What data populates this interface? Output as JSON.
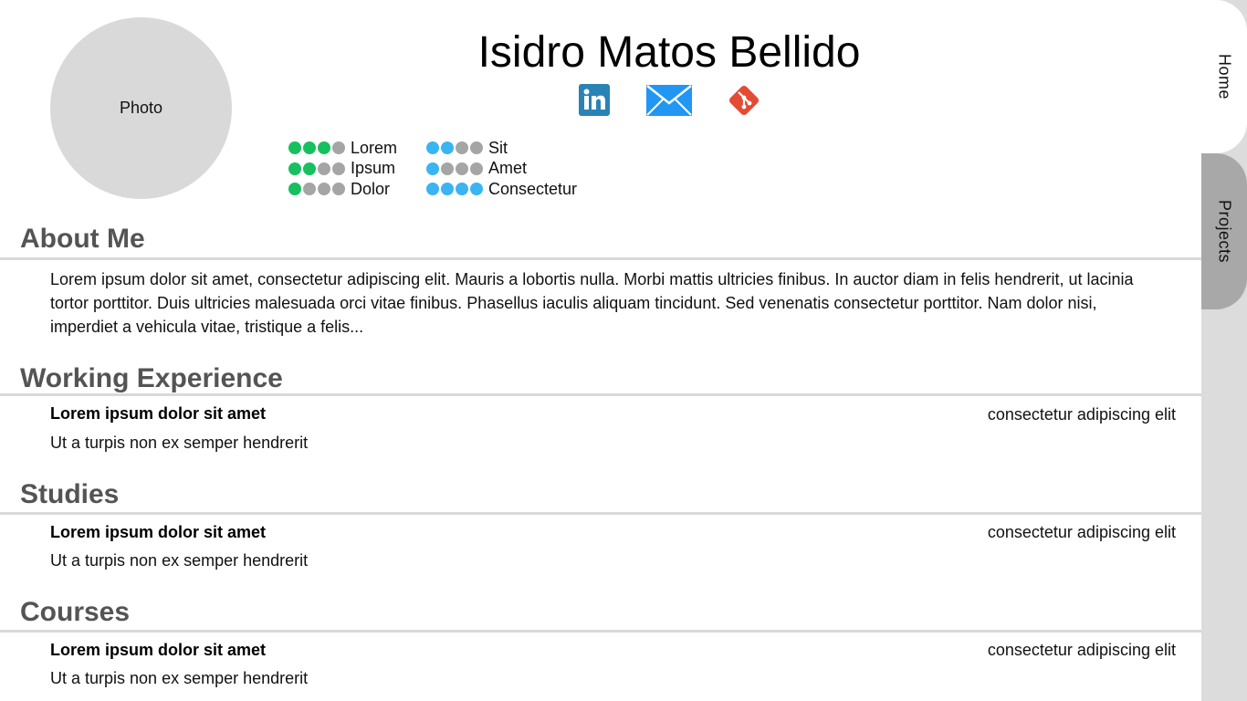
{
  "nav": {
    "tabs": [
      {
        "label": "Home"
      },
      {
        "label": "Projects"
      }
    ]
  },
  "profile": {
    "photo_label": "Photo",
    "name": "Isidro Matos Bellido",
    "socials": [
      {
        "icon": "linkedin-icon",
        "color": "#2a83b5"
      },
      {
        "icon": "mail-icon",
        "color": "#2196f3"
      },
      {
        "icon": "git-icon",
        "color": "#e44b33"
      }
    ]
  },
  "skills": {
    "dot_off_color": "#a5a5a5",
    "left": {
      "color": "#16c05f",
      "items": [
        {
          "label": "Lorem",
          "level": 3,
          "max": 4
        },
        {
          "label": "Ipsum",
          "level": 2,
          "max": 4
        },
        {
          "label": "Dolor",
          "level": 1,
          "max": 4
        }
      ]
    },
    "right": {
      "color": "#3bb4f2",
      "items": [
        {
          "label": "Sit",
          "level": 2,
          "max": 4
        },
        {
          "label": "Amet",
          "level": 1,
          "max": 4
        },
        {
          "label": "Consectetur",
          "level": 4,
          "max": 4
        }
      ]
    }
  },
  "about": {
    "title": "About Me",
    "text": "Lorem ipsum dolor sit amet, consectetur adipiscing elit. Mauris a lobortis nulla. Morbi mattis ultricies finibus. In auctor diam in felis hendrerit, ut lacinia tortor porttitor. Duis ultricies malesuada orci vitae finibus. Phasellus iaculis aliquam tincidunt. Sed venenatis consectetur porttitor. Nam dolor nisi, imperdiet a vehicula vitae, tristique a felis..."
  },
  "experience": {
    "title": "Working Experience",
    "entry": {
      "title": "Lorem ipsum dolor sit amet",
      "subtitle": "Ut a turpis non ex semper hendrerit",
      "right": "consectetur adipiscing elit"
    }
  },
  "studies": {
    "title": "Studies",
    "entry": {
      "title": "Lorem ipsum dolor sit amet",
      "subtitle": "Ut a turpis non ex semper hendrerit",
      "right": "consectetur adipiscing elit"
    }
  },
  "courses": {
    "title": "Courses",
    "entry": {
      "title": "Lorem ipsum dolor sit amet",
      "subtitle": "Ut a turpis non ex semper hendrerit",
      "right": "consectetur adipiscing elit"
    }
  }
}
